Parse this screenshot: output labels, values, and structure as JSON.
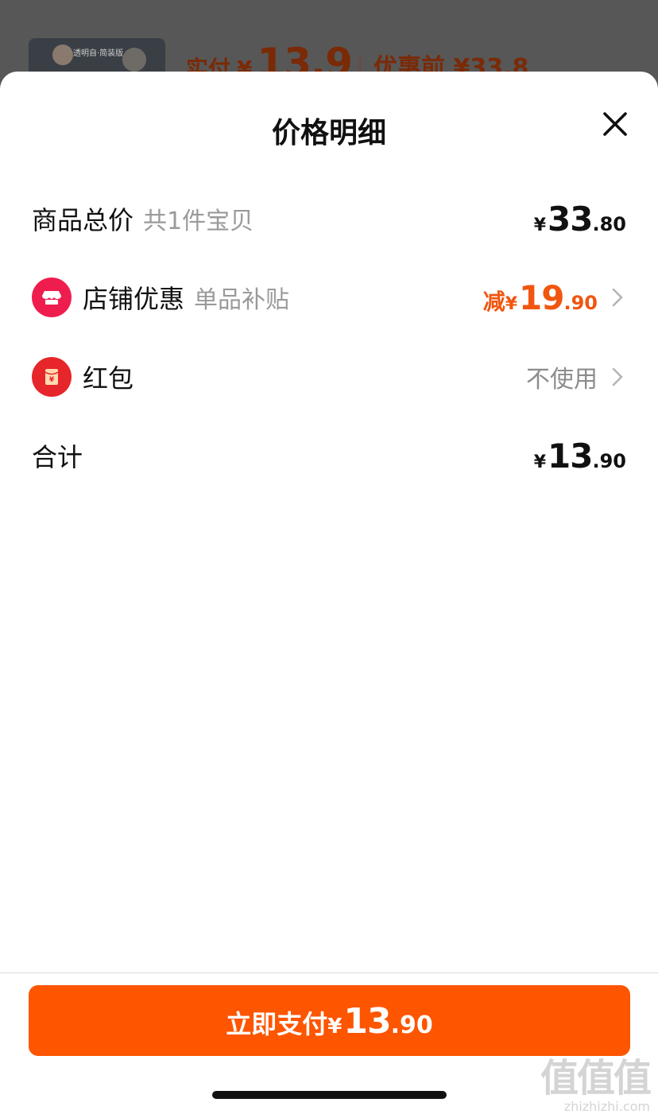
{
  "background": {
    "price_label": "实付",
    "price_currency": "¥",
    "price_value": "13.9",
    "before_label": "优惠前",
    "before_value": "¥33.8",
    "thumb_text": "透明自·简装版"
  },
  "sheet": {
    "title": "价格明细",
    "close_icon": "close-icon"
  },
  "rows": {
    "total_goods": {
      "label": "商品总价",
      "sub": "共1件宝贝",
      "currency": "¥",
      "amount_int": "33",
      "amount_dec": ".80"
    },
    "shop_discount": {
      "label": "店铺优惠",
      "sub": "单品补贴",
      "prefix": "减",
      "currency": "¥",
      "amount_int": "19",
      "amount_dec": ".90",
      "icon": "shop-icon",
      "icon_color": "#ef1d4e"
    },
    "red_packet": {
      "label": "红包",
      "value": "不使用",
      "icon": "red-packet-icon",
      "icon_color": "#e6262a"
    },
    "sum": {
      "label": "合计",
      "currency": "¥",
      "amount_int": "13",
      "amount_dec": ".90"
    }
  },
  "pay_button": {
    "label": "立即支付",
    "currency": "¥",
    "amount_int": "13",
    "amount_dec": ".90",
    "color": "#fe5500"
  },
  "watermark": {
    "big": "值值值",
    "small": "zhizhizhi.com"
  },
  "colors": {
    "accent": "#f0560f",
    "text": "#111111",
    "muted": "#9a9a9a"
  }
}
